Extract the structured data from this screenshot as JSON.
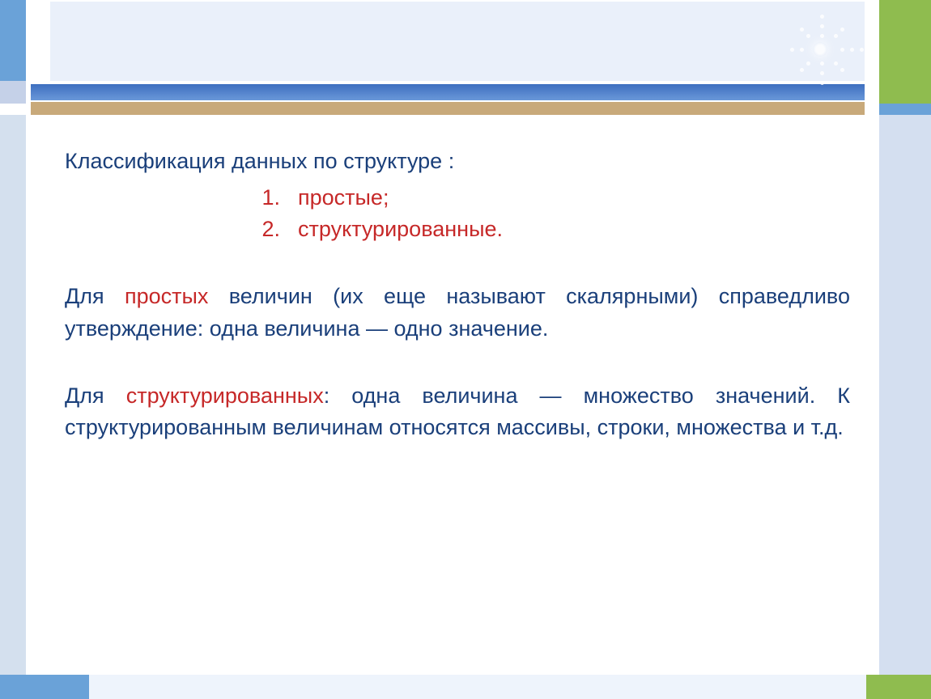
{
  "heading": "Классификация данных по структуре :",
  "list": {
    "item1_num": "1.",
    "item1_text": "простые;",
    "item2_num": "2.",
    "item2_text": "структурированные."
  },
  "para1": {
    "t1": "Для ",
    "red": "простых",
    "t2": " величин (их еще называют скалярными) справедливо утверждение: одна величина — одно значение."
  },
  "para2": {
    "t1": "Для ",
    "red": "структурированных",
    "t2": ": одна величина — множество значений. К структурированным величинам относятся массивы, строки, множества и т.д."
  }
}
